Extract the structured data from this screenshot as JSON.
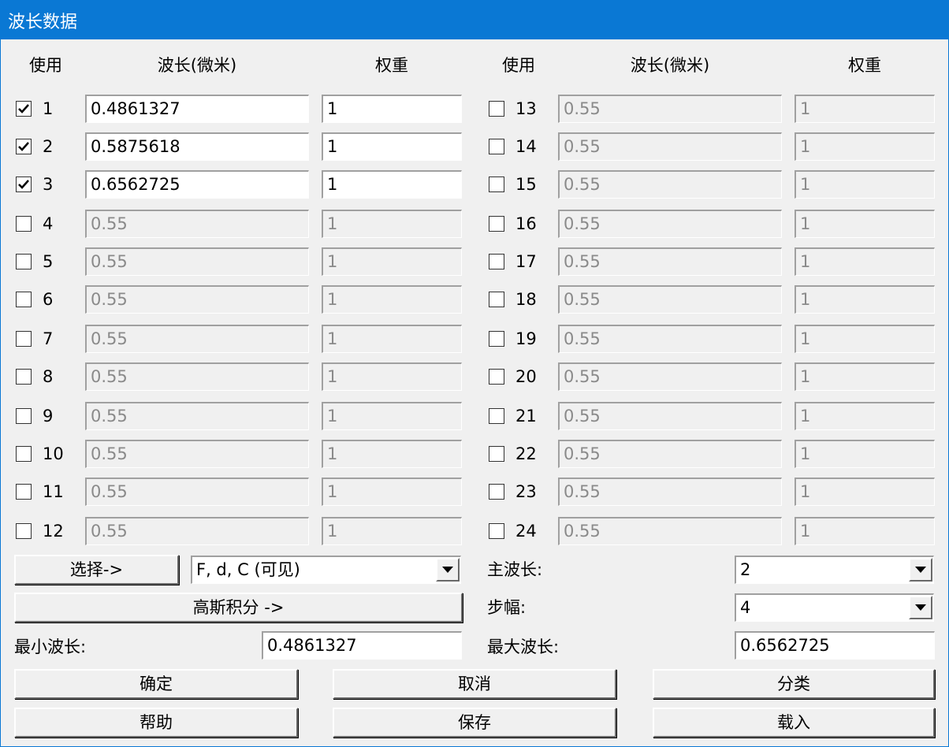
{
  "window": {
    "title": "波长数据"
  },
  "columns": {
    "use": "使用",
    "wavelength": "波长(微米)",
    "weight": "权重"
  },
  "rows": [
    {
      "num": "1",
      "checked": true,
      "wavelength": "0.4861327",
      "weight": "1"
    },
    {
      "num": "2",
      "checked": true,
      "wavelength": "0.5875618",
      "weight": "1"
    },
    {
      "num": "3",
      "checked": true,
      "wavelength": "0.6562725",
      "weight": "1"
    },
    {
      "num": "4",
      "checked": false,
      "wavelength": "0.55",
      "weight": "1"
    },
    {
      "num": "5",
      "checked": false,
      "wavelength": "0.55",
      "weight": "1"
    },
    {
      "num": "6",
      "checked": false,
      "wavelength": "0.55",
      "weight": "1"
    },
    {
      "num": "7",
      "checked": false,
      "wavelength": "0.55",
      "weight": "1"
    },
    {
      "num": "8",
      "checked": false,
      "wavelength": "0.55",
      "weight": "1"
    },
    {
      "num": "9",
      "checked": false,
      "wavelength": "0.55",
      "weight": "1"
    },
    {
      "num": "10",
      "checked": false,
      "wavelength": "0.55",
      "weight": "1"
    },
    {
      "num": "11",
      "checked": false,
      "wavelength": "0.55",
      "weight": "1"
    },
    {
      "num": "12",
      "checked": false,
      "wavelength": "0.55",
      "weight": "1"
    },
    {
      "num": "13",
      "checked": false,
      "wavelength": "0.55",
      "weight": "1"
    },
    {
      "num": "14",
      "checked": false,
      "wavelength": "0.55",
      "weight": "1"
    },
    {
      "num": "15",
      "checked": false,
      "wavelength": "0.55",
      "weight": "1"
    },
    {
      "num": "16",
      "checked": false,
      "wavelength": "0.55",
      "weight": "1"
    },
    {
      "num": "17",
      "checked": false,
      "wavelength": "0.55",
      "weight": "1"
    },
    {
      "num": "18",
      "checked": false,
      "wavelength": "0.55",
      "weight": "1"
    },
    {
      "num": "19",
      "checked": false,
      "wavelength": "0.55",
      "weight": "1"
    },
    {
      "num": "20",
      "checked": false,
      "wavelength": "0.55",
      "weight": "1"
    },
    {
      "num": "21",
      "checked": false,
      "wavelength": "0.55",
      "weight": "1"
    },
    {
      "num": "22",
      "checked": false,
      "wavelength": "0.55",
      "weight": "1"
    },
    {
      "num": "23",
      "checked": false,
      "wavelength": "0.55",
      "weight": "1"
    },
    {
      "num": "24",
      "checked": false,
      "wavelength": "0.55",
      "weight": "1"
    }
  ],
  "controls": {
    "select_button": "选择->",
    "preset_combo": "F, d, C (可见)",
    "gauss_button": "高斯积分 ->",
    "primary_label": "主波长:",
    "primary_value": "2",
    "step_label": "步幅:",
    "step_value": "4",
    "min_label": "最小波长:",
    "min_value": "0.4861327",
    "max_label": "最大波长:",
    "max_value": "0.6562725"
  },
  "buttons": {
    "ok": "确定",
    "cancel": "取消",
    "sort": "分类",
    "help": "帮助",
    "save": "保存",
    "load": "载入"
  }
}
